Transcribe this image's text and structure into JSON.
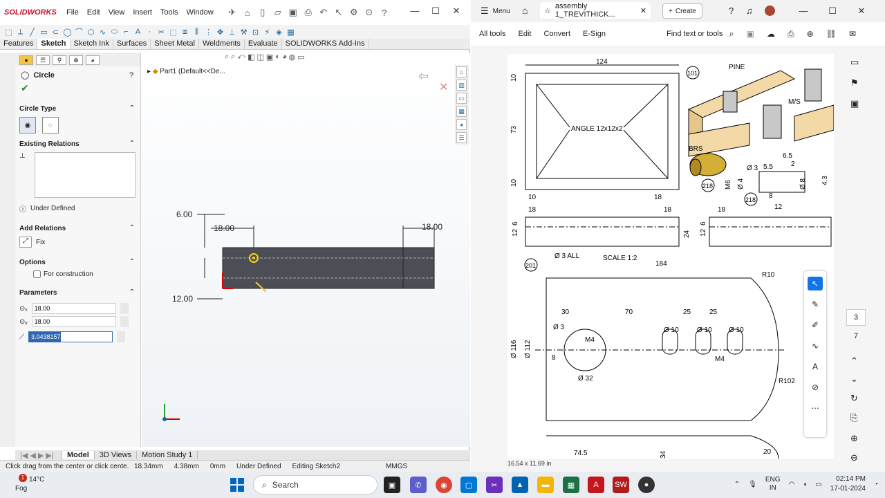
{
  "solidworks": {
    "logo": "SOLIDWORKS",
    "menu": [
      "File",
      "Edit",
      "View",
      "Insert",
      "Tools",
      "Window"
    ],
    "tabs": [
      "Features",
      "Sketch",
      "Sketch Ink",
      "Surfaces",
      "Sheet Metal",
      "Weldments",
      "Evaluate",
      "SOLIDWORKS Add-Ins"
    ],
    "active_tab": "Sketch",
    "tree_item": "Part1  (Default<<De...",
    "property_manager": {
      "title": "Circle",
      "circle_type_label": "Circle Type",
      "existing_relations_label": "Existing Relations",
      "under_defined": "Under Defined",
      "add_relations_label": "Add Relations",
      "fix_label": "Fix",
      "options_label": "Options",
      "for_construction": "For construction",
      "parameters_label": "Parameters",
      "param_x": "18.00",
      "param_y": "18.00",
      "param_r": "3.04381577"
    },
    "sketch": {
      "dim_left_top": "6.00",
      "dim_left_bottom": "12.00",
      "dim_h_left": "18.00",
      "dim_h_right": "18.00"
    },
    "bottom_tabs": [
      "Model",
      "3D Views",
      "Motion Study 1"
    ],
    "status": {
      "hint": "Click drag from the center or click cente...",
      "x": "18.34mm",
      "y": "4.38mm",
      "z": "0mm",
      "state": "Under Defined",
      "editing": "Editing Sketch2",
      "units": "MMGS"
    }
  },
  "acrobat": {
    "menu_label": "Menu",
    "tab_title": "assembly 1_TREVITHICK...",
    "create_label": "Create",
    "toolbar": [
      "All tools",
      "Edit",
      "Convert",
      "E-Sign"
    ],
    "find_label": "Find text or tools",
    "page_current": "3",
    "page_total": "7",
    "page_size": "16.54 x 11.69 in",
    "drawing": {
      "dim_124": "124",
      "dim_10a": "10",
      "dim_73": "73",
      "dim_10b": "10",
      "dim_10c": "10",
      "dim_18a": "18",
      "angle": "ANGLE 12x12x2",
      "balloon_101": "101",
      "pine": "PINE",
      "ms": "M/S",
      "brs": "BRS",
      "balloon_218a": "218",
      "balloon_218b": "218",
      "d3": "Ø 3",
      "d55": "5.5",
      "d65": "6.5",
      "d2": "2",
      "m6": "M6",
      "d4": "Ø 4",
      "d8": "Ø 8",
      "d43": "4.3",
      "d8b": "8",
      "d12": "12",
      "dim_18b": "18",
      "dim_18c": "18",
      "dim_18d": "18",
      "dim_12": "12",
      "dim_6": "6",
      "dim_24": "24",
      "dim_12b": "12",
      "dim_6b": "6",
      "d3all": "Ø 3  ALL",
      "scale": "SCALE  1:2",
      "balloon_201": "201",
      "dim_184": "184",
      "r10": "R10",
      "d30": "30",
      "d70": "70",
      "d25a": "25",
      "d25b": "25",
      "d3b": "Ø 3",
      "d116": "Ø 116",
      "d112": "Ø 112",
      "d8c": "8",
      "m4a": "M4",
      "d32": "Ø 32",
      "d10a": "Ø 10",
      "d10b": "Ø 10",
      "d10c": "Ø 10",
      "m4b": "M4",
      "r102": "R102",
      "d745": "74.5",
      "d34": "34",
      "d20": "20"
    }
  },
  "taskbar": {
    "temp": "14°C",
    "weather": "Fog",
    "badge": "1",
    "search": "Search",
    "lang": "ENG",
    "region": "IN",
    "time": "02:14 PM",
    "date": "17-01-2024"
  }
}
